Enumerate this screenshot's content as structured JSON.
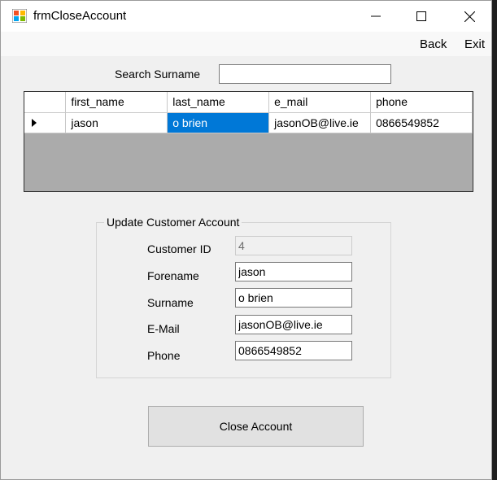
{
  "window": {
    "title": "frmCloseAccount",
    "controls": {
      "minimize": "minimize-icon",
      "maximize": "maximize-icon",
      "close": "close-icon"
    }
  },
  "menu": {
    "back_label": "Back",
    "exit_label": "Exit"
  },
  "search": {
    "label": "Search Surname",
    "value": ""
  },
  "grid": {
    "columns": [
      "first_name",
      "last_name",
      "e_mail",
      "phone"
    ],
    "rows": [
      {
        "first_name": "jason",
        "last_name": "o brien",
        "e_mail": "jasonOB@live.ie",
        "phone": "0866549852"
      }
    ],
    "selected_cell": "last_name"
  },
  "group": {
    "title": "Update Customer Account",
    "fields": {
      "customer_id": {
        "label": "Customer ID",
        "value": "4"
      },
      "forename": {
        "label": "Forename",
        "value": "jason"
      },
      "surname": {
        "label": "Surname",
        "value": "o brien"
      },
      "email": {
        "label": "E-Mail",
        "value": "jasonOB@live.ie"
      },
      "phone": {
        "label": "Phone",
        "value": "0866549852"
      }
    }
  },
  "actions": {
    "close_account_label": "Close Account"
  },
  "colors": {
    "selection": "#0078d7",
    "window_bg": "#f0f0f0",
    "grid_bg": "#ababab"
  }
}
